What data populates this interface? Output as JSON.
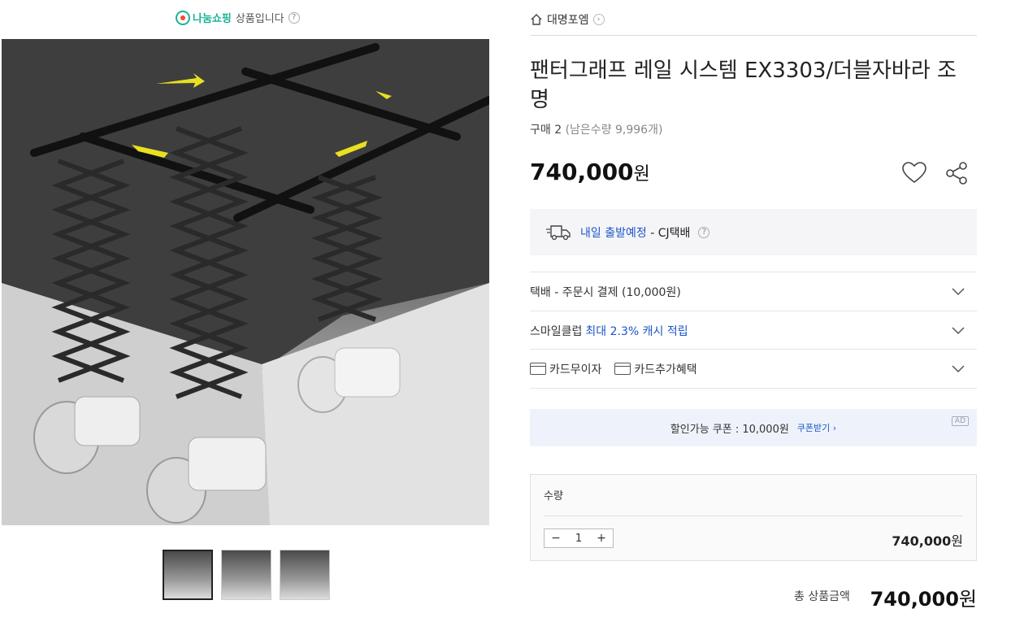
{
  "seller": {
    "brand": "나눔쇼핑",
    "suffix": "상품입니다",
    "help": "?"
  },
  "gallery": {
    "thumbnail_count": 3,
    "active_index": 0
  },
  "store": {
    "name": "대명포엠"
  },
  "product": {
    "title": "팬터그래프 레일 시스템 EX3303/더블자바라 조명",
    "purchase_label": "구매 2",
    "remaining": "(남은수량 9,996개)",
    "price": "740,000",
    "currency": "원"
  },
  "shipping": {
    "eta": "내일 출발예정",
    "carrier": "- CJ택배",
    "help": "?"
  },
  "options": {
    "delivery": "택배 - 주문시 결제 (10,000원)",
    "smile_prefix": "스마일클럽",
    "smile_benefit": "최대 2.3% 캐시 적립",
    "card_free": "카드무이자",
    "card_extra": "카드추가혜택"
  },
  "coupon": {
    "text": "할인가능 쿠폰 : 10,000원",
    "action": "쿠폰받기 ›",
    "ad": "AD"
  },
  "quantity": {
    "label": "수량",
    "minus": "−",
    "value": "1",
    "plus": "+",
    "price": "740,000",
    "currency": "원"
  },
  "total": {
    "label": "총 상품금액",
    "price": "740,000",
    "currency": "원"
  },
  "colors": {
    "accent_blue": "#1c56c8",
    "brand_green": "#19b394"
  }
}
